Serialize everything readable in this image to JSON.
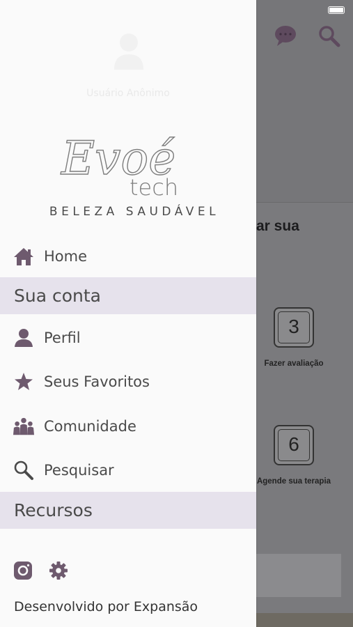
{
  "background": {
    "heading_fragment": "ar sua",
    "steps": [
      {
        "number": "3",
        "label": "Fazer avaliação"
      },
      {
        "number": "6",
        "label": "Agende sua terapia"
      }
    ]
  },
  "drawer": {
    "username": "Usuário Anônimo",
    "brand": {
      "script": "Evoé",
      "sub": "tech",
      "tagline": "BELEZA SAUDÁVEL"
    },
    "home_label": "Home",
    "sections": [
      {
        "title": "Sua conta",
        "items": [
          {
            "label": "Perfil",
            "icon": "person-icon"
          },
          {
            "label": "Seus Favoritos",
            "icon": "star-icon"
          },
          {
            "label": "Comunidade",
            "icon": "community-icon"
          },
          {
            "label": "Pesquisar",
            "icon": "search-icon"
          }
        ]
      },
      {
        "title": "Recursos",
        "items": []
      }
    ],
    "footer": {
      "credit": "Desenvolvido por Expansão"
    }
  },
  "colors": {
    "accent": "#6e5a6e",
    "section_bg": "#e6e2ec",
    "drawer_bg": "#fafafa"
  }
}
